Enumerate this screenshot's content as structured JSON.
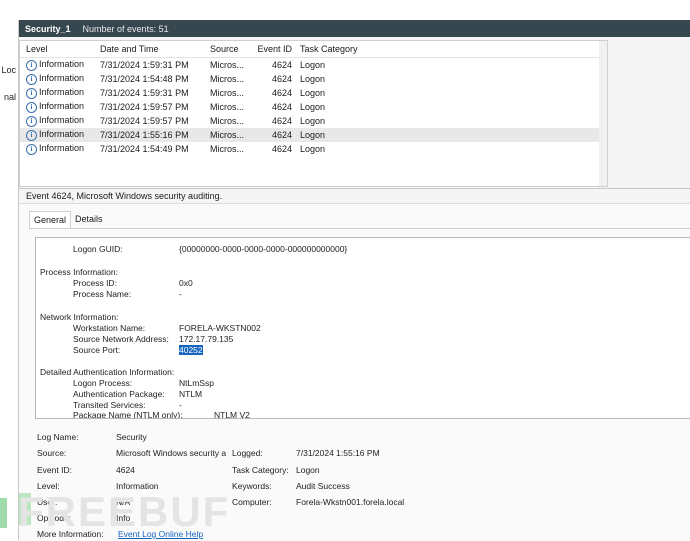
{
  "left_nav": {
    "frag1": "Loc",
    "frag2": "nal"
  },
  "header": {
    "name": "Security_1",
    "count": "Number of events: 51"
  },
  "columns": {
    "level": "Level",
    "date": "Date and Time",
    "source": "Source",
    "event_id": "Event ID",
    "task": "Task Category"
  },
  "events": [
    {
      "level": "Information",
      "date": "7/31/2024 1:59:31 PM",
      "source": "Micros...",
      "event_id": "4624",
      "task": "Logon"
    },
    {
      "level": "Information",
      "date": "7/31/2024 1:54:48 PM",
      "source": "Micros...",
      "event_id": "4624",
      "task": "Logon"
    },
    {
      "level": "Information",
      "date": "7/31/2024 1:59:31 PM",
      "source": "Micros...",
      "event_id": "4624",
      "task": "Logon"
    },
    {
      "level": "Information",
      "date": "7/31/2024 1:59:57 PM",
      "source": "Micros...",
      "event_id": "4624",
      "task": "Logon"
    },
    {
      "level": "Information",
      "date": "7/31/2024 1:59:57 PM",
      "source": "Micros...",
      "event_id": "4624",
      "task": "Logon"
    },
    {
      "level": "Information",
      "date": "7/31/2024 1:55:16 PM",
      "source": "Micros...",
      "event_id": "4624",
      "task": "Logon"
    },
    {
      "level": "Information",
      "date": "7/31/2024 1:54:49 PM",
      "source": "Micros...",
      "event_id": "4624",
      "task": "Logon"
    }
  ],
  "detail": {
    "title": "Event 4624, Microsoft Windows security auditing.",
    "tab_general": "General",
    "tab_details": "Details",
    "text": {
      "logon_guid_label": "Logon GUID:",
      "logon_guid_value": "{00000000-0000-0000-0000-000000000000}",
      "proc_info": "Process Information:",
      "proc_id_label": "Process ID:",
      "proc_id_value": "0x0",
      "proc_name_label": "Process Name:",
      "proc_name_value": "-",
      "net_info": "Network Information:",
      "ws_label": "Workstation Name:",
      "ws_value": "FORELA-WKSTN002",
      "addr_label": "Source Network Address:",
      "addr_value": "172.17.79.135",
      "port_label": "Source Port:",
      "port_value": "40252",
      "auth_info": "Detailed Authentication Information:",
      "lproc_label": "Logon Process:",
      "lproc_value": "NtLmSsp",
      "apkg_label": "Authentication Package:",
      "apkg_value": "NTLM",
      "transited_label": "Transited Services:",
      "transited_value": "-",
      "pkg_label": "Package Name (NTLM only):",
      "pkg_value": "NTLM V2"
    },
    "props": {
      "log_name_label": "Log Name:",
      "log_name_value": "Security",
      "source_label": "Source:",
      "source_value": "Microsoft Windows security a",
      "logged_label": "Logged:",
      "logged_value": "7/31/2024 1:55:16 PM",
      "event_id_label": "Event ID:",
      "event_id_value": "4624",
      "task_label": "Task Category:",
      "task_value": "Logon",
      "level_label": "Level:",
      "level_value": "Information",
      "keywords_label": "Keywords:",
      "keywords_value": "Audit Success",
      "user_label": "User:",
      "user_value": "N/A",
      "computer_label": "Computer:",
      "computer_value": "Forela-Wkstn001.forela.local",
      "opcode_label": "OpCode:",
      "opcode_value": "Info",
      "more_label": "More Information:",
      "more_link": "Event Log Online Help"
    }
  },
  "watermark": "FREEBUF"
}
